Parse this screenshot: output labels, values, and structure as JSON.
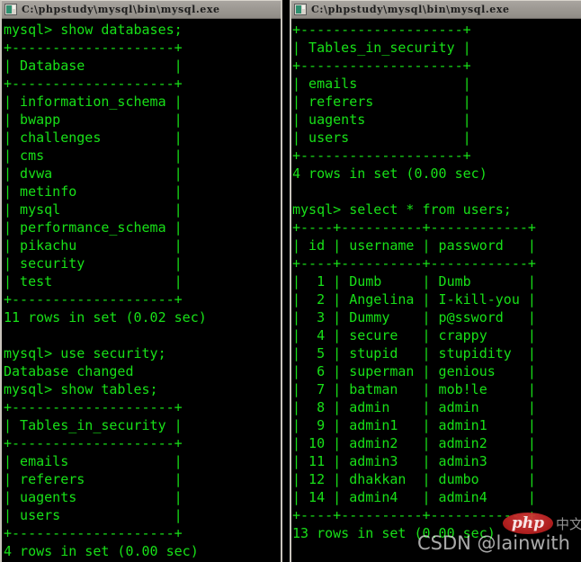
{
  "windows": {
    "left": {
      "title": "C:\\phpstudy\\mysql\\bin\\mysql.exe",
      "icon": "console-icon",
      "lines": [
        "mysql> show databases;",
        "+--------------------+",
        "| Database           |",
        "+--------------------+",
        "| information_schema |",
        "| bwapp              |",
        "| challenges         |",
        "| cms                |",
        "| dvwa               |",
        "| metinfo            |",
        "| mysql              |",
        "| performance_schema |",
        "| pikachu            |",
        "| security           |",
        "| test               |",
        "+--------------------+",
        "11 rows in set (0.02 sec)",
        "",
        "mysql> use security;",
        "Database changed",
        "mysql> show tables;",
        "+--------------------+",
        "| Tables_in_security |",
        "+--------------------+",
        "| emails             |",
        "| referers           |",
        "| uagents            |",
        "| users              |",
        "+--------------------+",
        "4 rows in set (0.00 sec)"
      ]
    },
    "right": {
      "title": "C:\\phpstudy\\mysql\\bin\\mysql.exe",
      "icon": "console-icon",
      "lines": [
        "+--------------------+",
        "| Tables_in_security |",
        "+--------------------+",
        "| emails             |",
        "| referers           |",
        "| uagents            |",
        "| users              |",
        "+--------------------+",
        "4 rows in set (0.00 sec)",
        "",
        "mysql> select * from users;",
        "+----+----------+------------+",
        "| id | username | password   |",
        "+----+----------+------------+",
        "|  1 | Dumb     | Dumb       |",
        "|  2 | Angelina | I-kill-you |",
        "|  3 | Dummy    | p@ssword   |",
        "|  4 | secure   | crappy     |",
        "|  5 | stupid   | stupidity  |",
        "|  6 | superman | genious    |",
        "|  7 | batman   | mob!le     |",
        "|  8 | admin    | admin      |",
        "|  9 | admin1   | admin1     |",
        "| 10 | admin2   | admin2     |",
        "| 11 | admin3   | admin3     |",
        "| 12 | dhakkan  | dumbo      |",
        "| 14 | admin4   | admin4     |",
        "+----+----------+------------+",
        "13 rows in set (0.00 sec)"
      ]
    }
  },
  "watermarks": {
    "csdn": "CSDN @lainwith",
    "php": "php",
    "cn": "中文网"
  },
  "colors": {
    "terminal_text": "#18e018",
    "terminal_bg": "#000000",
    "titlebar": "#9c9892",
    "php_badge": "#bb1f1f"
  },
  "query_results": {
    "databases": {
      "column": "Database",
      "rows": [
        "information_schema",
        "bwapp",
        "challenges",
        "cms",
        "dvwa",
        "metinfo",
        "mysql",
        "performance_schema",
        "pikachu",
        "security",
        "test"
      ],
      "row_count": 11,
      "duration": "0.02 sec"
    },
    "tables_in_security": {
      "column": "Tables_in_security",
      "rows": [
        "emails",
        "referers",
        "uagents",
        "users"
      ],
      "row_count": 4,
      "duration": "0.00 sec"
    },
    "users": {
      "columns": [
        "id",
        "username",
        "password"
      ],
      "rows": [
        [
          "1",
          "Dumb",
          "Dumb"
        ],
        [
          "2",
          "Angelina",
          "I-kill-you"
        ],
        [
          "3",
          "Dummy",
          "p@ssword"
        ],
        [
          "4",
          "secure",
          "crappy"
        ],
        [
          "5",
          "stupid",
          "stupidity"
        ],
        [
          "6",
          "superman",
          "genious"
        ],
        [
          "7",
          "batman",
          "mob!le"
        ],
        [
          "8",
          "admin",
          "admin"
        ],
        [
          "9",
          "admin1",
          "admin1"
        ],
        [
          "10",
          "admin2",
          "admin2"
        ],
        [
          "11",
          "admin3",
          "admin3"
        ],
        [
          "12",
          "dhakkan",
          "dumbo"
        ],
        [
          "14",
          "admin4",
          "admin4"
        ]
      ],
      "row_count": 13,
      "duration": "0.00 sec"
    }
  }
}
